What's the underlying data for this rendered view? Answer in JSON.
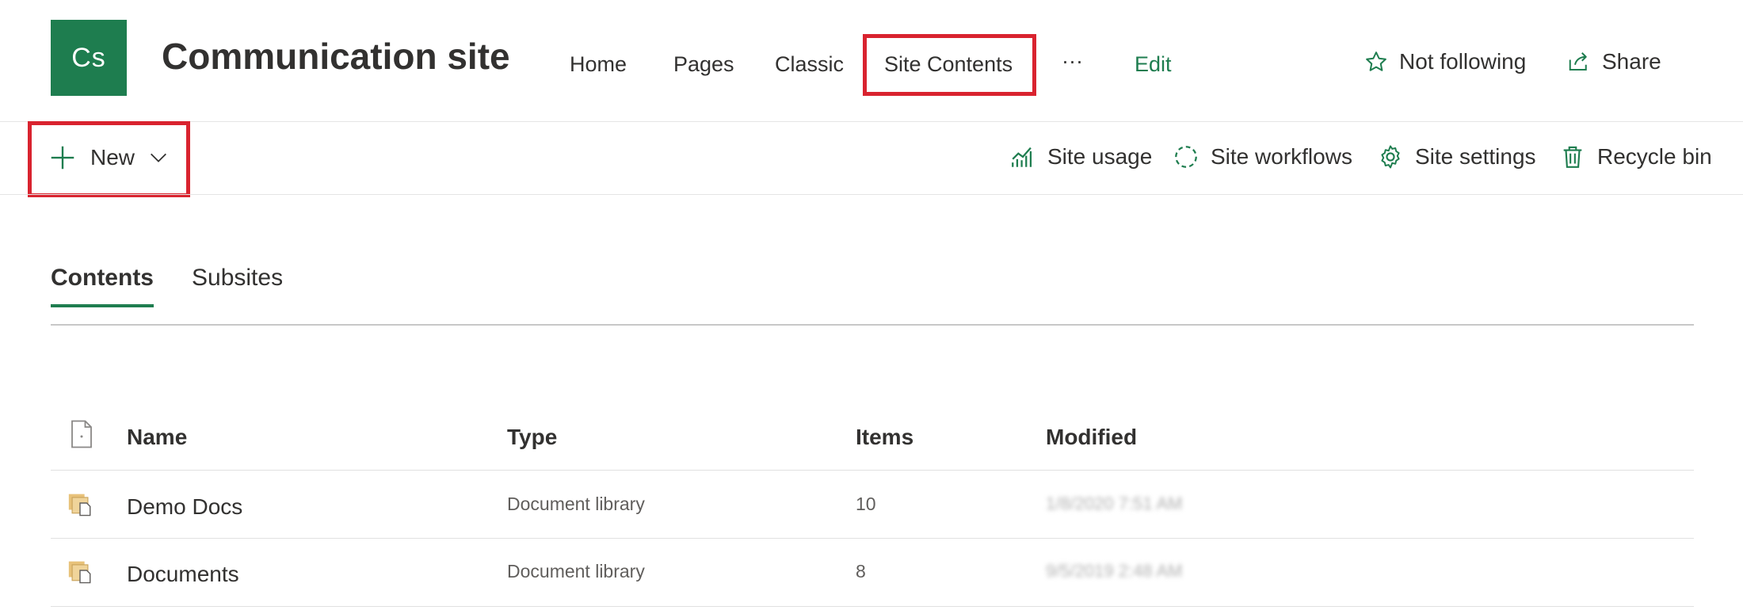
{
  "header": {
    "logo_initials": "Cs",
    "site_title": "Communication site",
    "nav": [
      "Home",
      "Pages",
      "Classic",
      "Site Contents"
    ],
    "more": "···",
    "edit": "Edit",
    "follow": "Not following",
    "share": "Share"
  },
  "commandbar": {
    "new_label": "New",
    "site_usage": "Site usage",
    "site_workflows": "Site workflows",
    "site_settings": "Site settings",
    "recycle_bin": "Recycle bin"
  },
  "tabs": [
    "Contents",
    "Subsites"
  ],
  "table": {
    "columns": [
      "Name",
      "Type",
      "Items",
      "Modified"
    ],
    "rows": [
      {
        "name": "Demo Docs",
        "type": "Document library",
        "items": "10",
        "modified": "1/8/2020 7:51 AM"
      },
      {
        "name": "Documents",
        "type": "Document library",
        "items": "8",
        "modified": "9/5/2019 2:48 AM"
      }
    ]
  },
  "colors": {
    "accent": "#1e7d4f",
    "highlight": "#d9232f"
  }
}
